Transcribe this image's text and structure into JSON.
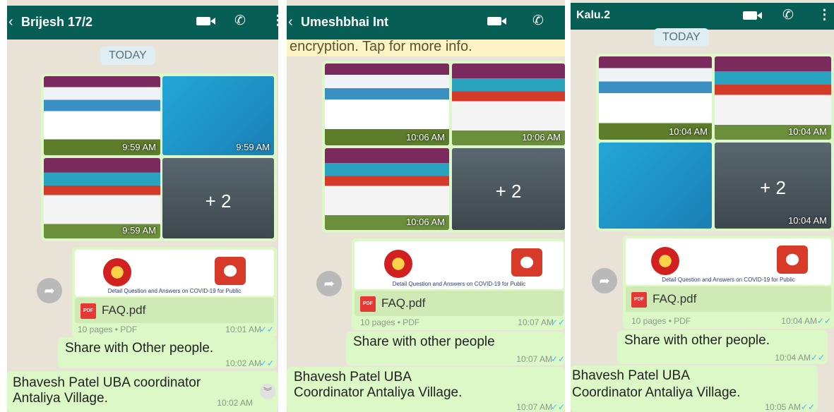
{
  "panels": [
    {
      "contact": "Brijesh 17/2",
      "date_chip": "TODAY",
      "banner": "",
      "tile_times": [
        "9:59 AM",
        "9:59 AM",
        "9:59 AM",
        ""
      ],
      "more_count": "+ 2",
      "pdf": {
        "name": "FAQ.pdf",
        "icon": "PDF",
        "meta": "10 pages • PDF",
        "time": "10:01 AM",
        "caption": "Detail Question and Answers on COVID-19 for Public"
      },
      "share": {
        "text": "Share with Other people.",
        "time": "10:02 AM"
      },
      "bottom": {
        "line1": "Bhavesh Patel UBA coordinator",
        "line2": "Antaliya Village.",
        "time": "10:02 AM"
      }
    },
    {
      "contact": "Umeshbhai Int",
      "date_chip": "",
      "banner": "encryption. Tap for more info.",
      "tile_times": [
        "10:06 AM",
        "10:06 AM",
        "10:06 AM",
        ""
      ],
      "more_count": "+ 2",
      "pdf": {
        "name": "FAQ.pdf",
        "icon": "PDF",
        "meta": "10 pages • PDF",
        "time": "10:07 AM",
        "caption": "Detail Question and Answers on COVID-19 for Public"
      },
      "share": {
        "text": "Share with other people",
        "time": "10:07 AM"
      },
      "bottom": {
        "line1": "Bhavesh Patel UBA",
        "line2": "Coordinator Antaliya Village.",
        "time": "10:07 AM"
      }
    },
    {
      "contact": "Kalu.2",
      "date_chip": "TODAY",
      "banner": "",
      "tile_times": [
        "10:04 AM",
        "10:04 AM",
        "",
        "10:04 AM"
      ],
      "more_count": "+ 2",
      "pdf": {
        "name": "FAQ.pdf",
        "icon": "PDF",
        "meta": "10 pages • PDF",
        "time": "10:04 AM",
        "caption": "Detail Question and Answers on COVID-19 for Public"
      },
      "share": {
        "text": "Share with other people.",
        "time": "10:04 AM"
      },
      "bottom": {
        "line1": "Bhavesh Patel UBA",
        "line2": "Coordinator Antaliya Village.",
        "time": "10:05 AM"
      }
    }
  ],
  "icons": {
    "back": "back-arrow-icon",
    "video": "video-call-icon",
    "phone": "phone-icon",
    "menu": "menu-dots-icon",
    "ticks": "double-tick-icon",
    "forward": "forward-icon"
  },
  "glyphs": {
    "phone": "✆",
    "menu": "⋮",
    "ticks": "✓✓",
    "forward": "➦",
    "back": "‹",
    "chevron": "︾"
  },
  "colors": {
    "header": "#075e54",
    "bubble": "#dcf8c6",
    "wallpaper": "#e9e2d6",
    "tick_blue": "#4fb6ec"
  }
}
